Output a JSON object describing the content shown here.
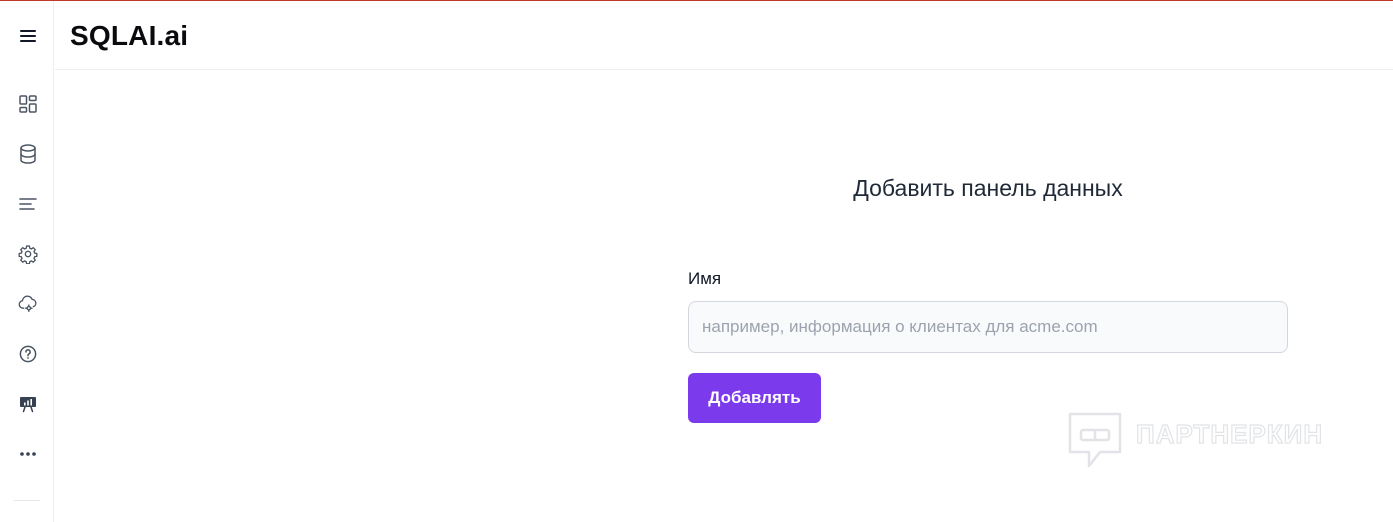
{
  "app": {
    "brand": "SQLAI.ai"
  },
  "sidebar": {
    "items": [
      {
        "icon": "menu-icon"
      },
      {
        "icon": "dashboard-icon"
      },
      {
        "icon": "database-icon"
      },
      {
        "icon": "list-icon"
      },
      {
        "icon": "gear-icon"
      },
      {
        "icon": "cloud-settings-icon"
      },
      {
        "icon": "help-icon"
      },
      {
        "icon": "presentation-chart-icon"
      },
      {
        "icon": "more-icon"
      }
    ]
  },
  "main": {
    "title": "Добавить панель данных",
    "form": {
      "name_label": "Имя",
      "name_placeholder": "например, информация о клиентах для acme.com",
      "name_value": "",
      "submit_label": "Добавлять"
    }
  },
  "watermark": {
    "text": "ПАРТНЕРКИН"
  },
  "colors": {
    "accent": "#7c3aed",
    "border": "#eceef1",
    "icon": "#4b5563"
  }
}
